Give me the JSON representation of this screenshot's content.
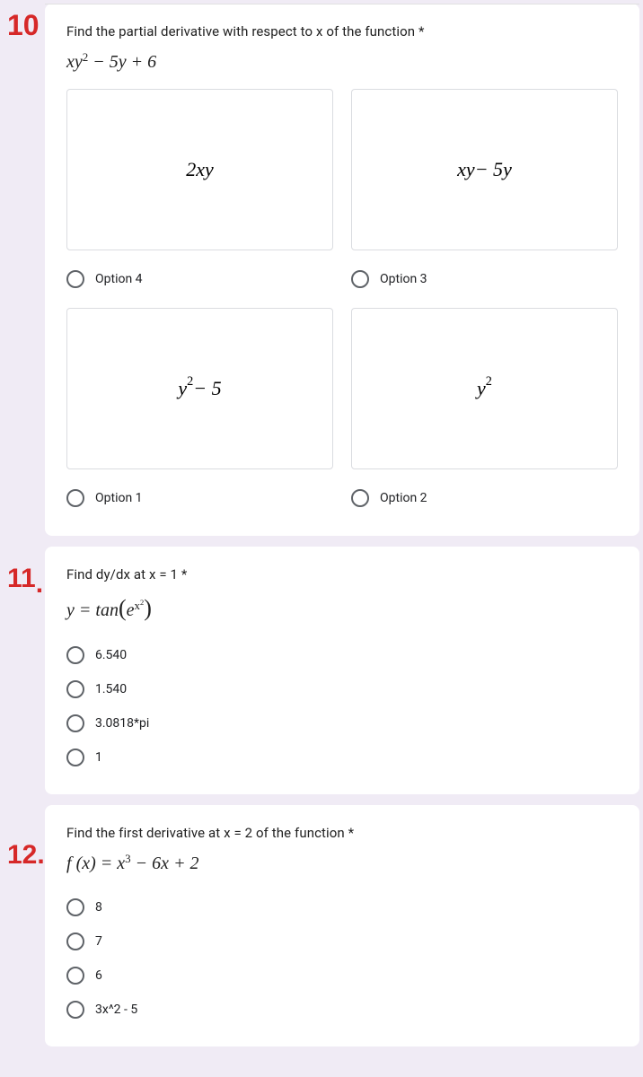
{
  "annotations": {
    "n10": "10",
    "n11": "11",
    "n12": "12."
  },
  "q10": {
    "prompt": "Find the partial derivative with respect to x of the function *",
    "formula_html": "<span class='it'>xy</span><span class='sup'>2</span> − 5<span class='it'>y</span> + 6",
    "options": [
      {
        "display_html": "2<span class='it'>xy</span>",
        "label": "Option 4"
      },
      {
        "display_html": "<span class='it'>xy</span> − 5<span class='it'>y</span>",
        "label": "Option 3"
      },
      {
        "display_html": "<span class='it'>y</span><span class='sup'>2</span> − 5",
        "label": "Option 1"
      },
      {
        "display_html": "<span class='it'>y</span><span class='sup'>2</span>",
        "label": "Option 2"
      }
    ]
  },
  "q11": {
    "prompt": "Find dy/dx at x = 1 *",
    "formula_html": "<span class='it'>y</span> = tan<span class='paren'>(</span><span class='it'>e</span><span class='sup'><span class='it'>x</span><span class='sup'>2</span></span><span class='paren'>)</span>",
    "options": [
      {
        "label": "6.540"
      },
      {
        "label": "1.540"
      },
      {
        "label": "3.0818*pi"
      },
      {
        "label": "1"
      }
    ]
  },
  "q12": {
    "prompt": "Find the first derivative at x = 2 of the function *",
    "formula_html": "<span class='it'>f</span> (<span class='it'>x</span>) = <span class='it'>x</span><span class='sup'>3</span> − 6<span class='it'>x</span> + 2",
    "options": [
      {
        "label": "8"
      },
      {
        "label": "7"
      },
      {
        "label": "6"
      },
      {
        "label": "3x^2 - 5"
      }
    ]
  }
}
